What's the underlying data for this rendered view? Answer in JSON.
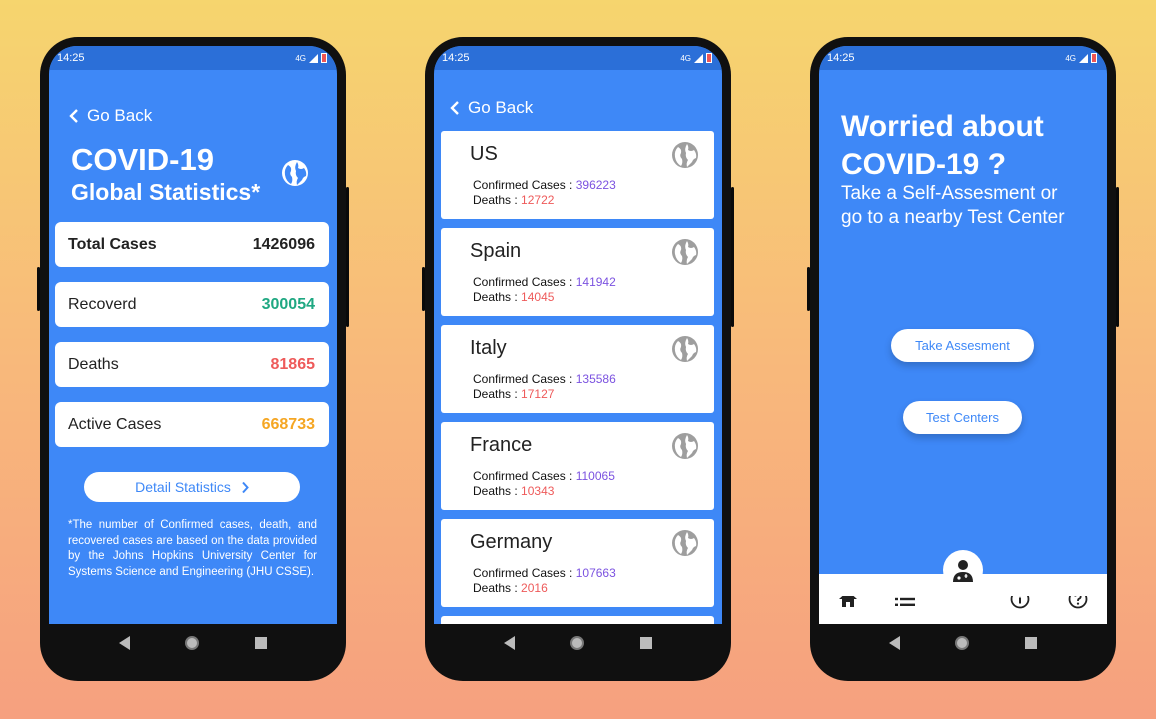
{
  "status": {
    "time": "14:25",
    "network": "4G"
  },
  "phone1": {
    "back_label": "Go Back",
    "title_line1": "COVID-19",
    "title_line2": "Global Statistics*",
    "stats": [
      {
        "label": "Total Cases",
        "value": "1426096",
        "color": "#222222"
      },
      {
        "label": "Recoverd",
        "value": "300054",
        "color": "#1fa882"
      },
      {
        "label": "Deaths",
        "value": "81865",
        "color": "#ee5a5a"
      },
      {
        "label": "Active Cases",
        "value": "668733",
        "color": "#f5a623"
      }
    ],
    "detail_button": "Detail Statistics",
    "footnote": "*The number of Confirmed cases, death, and recovered cases are based on the data provided by the Johns Hopkins University Center for Systems Science and Engineering (JHU CSSE)."
  },
  "phone2": {
    "back_label": "Go Back",
    "confirmed_label": "Confirmed Cases :",
    "deaths_label": "Deaths :",
    "countries": [
      {
        "name": "US",
        "confirmed": "396223",
        "deaths": "12722"
      },
      {
        "name": "Spain",
        "confirmed": "141942",
        "deaths": "14045"
      },
      {
        "name": "Italy",
        "confirmed": "135586",
        "deaths": "17127"
      },
      {
        "name": "France",
        "confirmed": "110065",
        "deaths": "10343"
      },
      {
        "name": "Germany",
        "confirmed": "107663",
        "deaths": "2016"
      }
    ]
  },
  "phone3": {
    "title_line1": "Worried about",
    "title_line2": "COVID-19 ?",
    "subtitle_line1": "Take a Self-Assesment or",
    "subtitle_line2": "go to a nearby Test Center",
    "take_assessment": "Take Assesment",
    "test_centers": "Test Centers",
    "bottom_nav_icons": [
      "home-icon",
      "list-icon",
      "doctor-icon",
      "info-icon",
      "help-icon"
    ]
  },
  "colors": {
    "accent": "#3e88f7",
    "background_top": "#f6d56e",
    "background_bottom": "#f6a07f"
  }
}
